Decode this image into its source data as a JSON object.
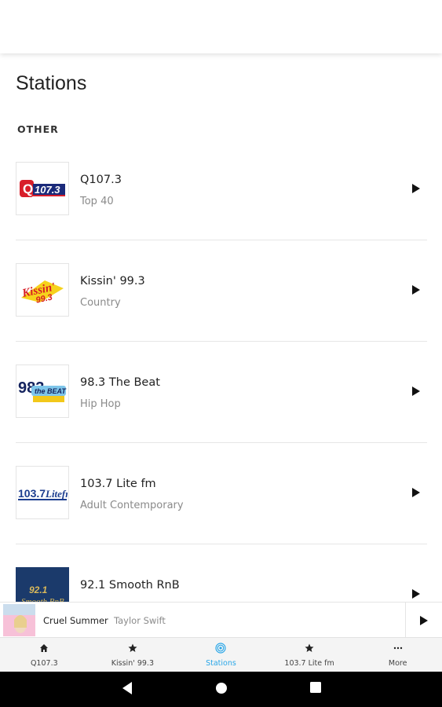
{
  "page": {
    "title": "Stations",
    "section_label": "OTHER"
  },
  "stations": [
    {
      "name": "Q107.3",
      "genre": "Top 40",
      "logo": "q1073-logo"
    },
    {
      "name": "Kissin' 99.3",
      "genre": "Country",
      "logo": "kissin-993-logo"
    },
    {
      "name": "98.3 The Beat",
      "genre": "Hip Hop",
      "logo": "983-the-beat-logo"
    },
    {
      "name": "103.7 Lite fm",
      "genre": "Adult Contemporary",
      "logo": "1037-lite-fm-logo"
    },
    {
      "name": "92.1 Smooth RnB",
      "genre": "",
      "logo": "921-smooth-rnb-logo"
    }
  ],
  "now_playing": {
    "title": "Cruel Summer",
    "artist": "Taylor Swift"
  },
  "tabs": [
    {
      "label": "Q107.3",
      "icon": "home-icon",
      "active": false
    },
    {
      "label": "Kissin' 99.3",
      "icon": "star-icon",
      "active": false
    },
    {
      "label": "Stations",
      "icon": "radio-icon",
      "active": true
    },
    {
      "label": "103.7 Lite fm",
      "icon": "star-icon",
      "active": false
    },
    {
      "label": "More",
      "icon": "more-icon",
      "active": false
    }
  ],
  "colors": {
    "accent": "#2aa7e8",
    "divider": "#e6e6e6",
    "secondary_text": "#8a8a8a"
  }
}
